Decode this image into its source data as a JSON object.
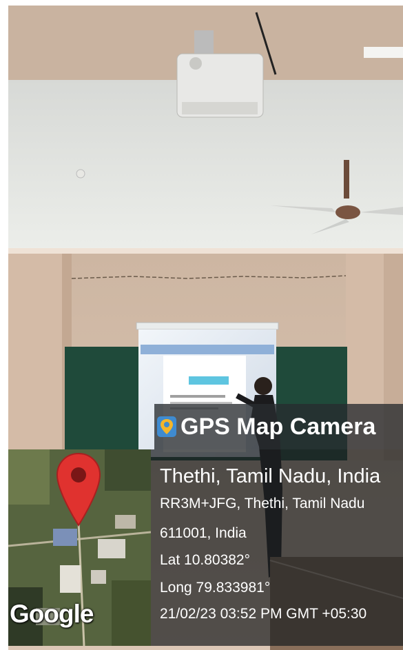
{
  "overlay": {
    "app_name": "GPS Map Camera",
    "place": "Thethi, Tamil Nadu, India",
    "address_line1": "RR3M+JFG, Thethi, Tamil Nadu",
    "address_line2": "611001, India",
    "latitude": "Lat 10.80382°",
    "longitude": "Long 79.833981°",
    "timestamp": "21/02/23 03:52 PM GMT +05:30",
    "map_brand": "Google"
  },
  "icons": {
    "app_logo": "map-pin-camera-icon",
    "location_pin": "location-pin-icon"
  },
  "colors": {
    "wall": "#d9c2b0",
    "ceiling": "#e4e6e3",
    "chalkboard": "#1f4a3a",
    "map_pin": "#e0322f"
  }
}
